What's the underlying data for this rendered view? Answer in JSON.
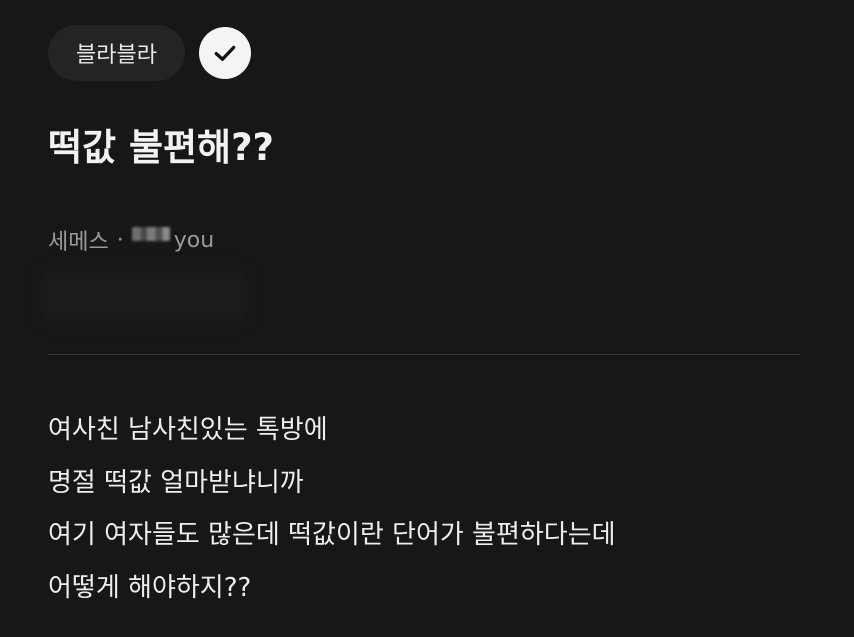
{
  "topic": {
    "chip_label": "블라블라",
    "check_icon": "check-icon"
  },
  "post": {
    "title": "떡값 불편해??",
    "company": "세메스",
    "separator": "·",
    "author_suffix": "you",
    "body_lines": [
      "여사친 남사친있는 톡방에",
      "명절 떡값 얼마받냐니까",
      "여기 여자들도 많은데 떡값이란 단어가 불편하다는데",
      "어떻게 해야하지??"
    ]
  },
  "colors": {
    "background": "#171717",
    "chip_background": "#242424",
    "text_primary": "#ededed",
    "text_secondary": "#9a9a9a",
    "divider": "#353535"
  }
}
